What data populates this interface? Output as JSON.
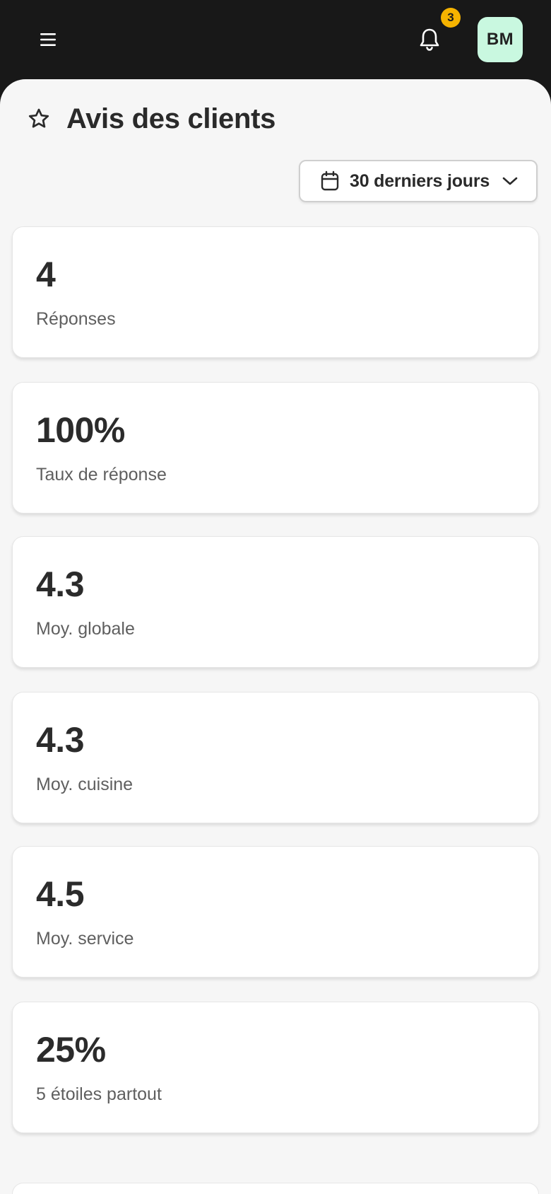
{
  "header": {
    "menu_icon": "hamburger-menu-icon",
    "bell_icon": "bell-icon",
    "notification_count": "3",
    "avatar_initials": "BM",
    "avatar_color": "#c9f8e0",
    "badge_color": "#f5b300"
  },
  "page": {
    "title": "Avis des clients",
    "title_icon": "star-icon"
  },
  "filter": {
    "icon": "calendar-icon",
    "selected_range": "30 derniers jours",
    "chevron": "chevron-down-icon"
  },
  "stats": [
    {
      "value": "4",
      "label": "Réponses"
    },
    {
      "value": "100%",
      "label": "Taux de réponse"
    },
    {
      "value": "4.3",
      "label": "Moy. globale"
    },
    {
      "value": "4.3",
      "label": "Moy. cuisine"
    },
    {
      "value": "4.5",
      "label": "Moy. service"
    },
    {
      "value": "25%",
      "label": "5 étoiles partout"
    }
  ]
}
